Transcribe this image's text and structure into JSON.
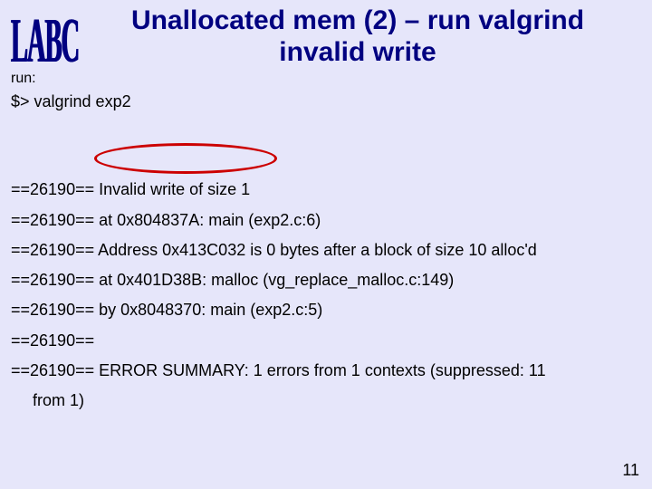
{
  "logo": "LABC",
  "title_line1": "Unallocated mem (2) – run valgrind",
  "title_line2": "invalid write",
  "run_label": "run:",
  "cmd": "$>  valgrind exp2",
  "output": {
    "l1": "==26190== Invalid write of size 1",
    "l2": "==26190== at 0x804837A: main (exp2.c:6)",
    "l3": "==26190== Address 0x413C032 is 0 bytes after a block of size 10 alloc'd",
    "l4": "==26190== at 0x401D38B: malloc (vg_replace_malloc.c:149)",
    "l5": "==26190== by 0x8048370: main (exp2.c:5)",
    "l6": "==26190==",
    "l7": "==26190== ERROR SUMMARY: 1 errors from 1 contexts (suppressed: 11",
    "l8": "from 1)"
  },
  "page_number": "11"
}
